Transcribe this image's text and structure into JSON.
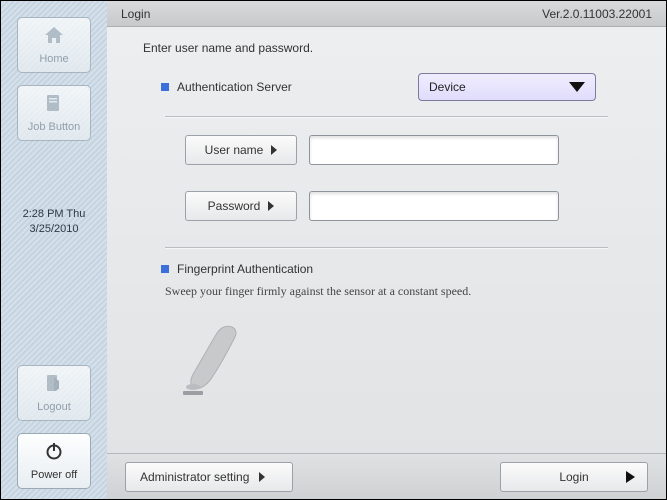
{
  "sidebar": {
    "home": "Home",
    "job_button": "Job Button",
    "logout": "Logout",
    "power_off": "Power off",
    "time": "2:28 PM  Thu",
    "date": "3/25/2010"
  },
  "header": {
    "title": "Login",
    "version": "Ver.2.0.11003.22001"
  },
  "login": {
    "instruction": "Enter user name and password.",
    "auth_server_label": "Authentication Server",
    "auth_server_value": "Device",
    "username_label": "User name",
    "username_value": "",
    "password_label": "Password",
    "password_value": "",
    "fingerprint_label": "Fingerprint Authentication",
    "fingerprint_hint": "Sweep your finger firmly against the sensor at a constant speed."
  },
  "footer": {
    "admin": "Administrator setting",
    "login": "Login"
  }
}
